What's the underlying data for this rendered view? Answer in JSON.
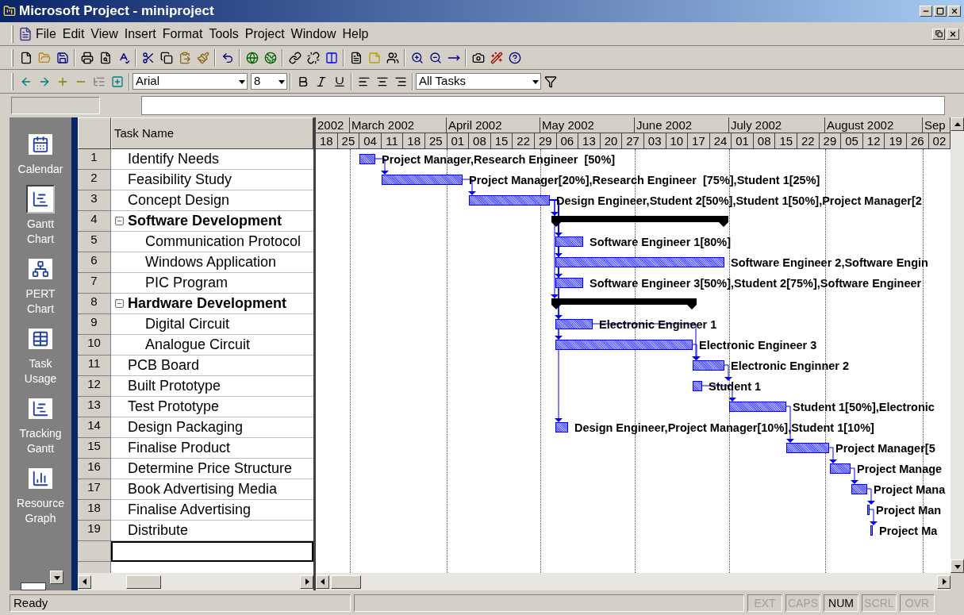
{
  "window": {
    "title": "Microsoft Project - miniproject"
  },
  "menu": [
    "File",
    "Edit",
    "View",
    "Insert",
    "Format",
    "Tools",
    "Project",
    "Window",
    "Help"
  ],
  "formatting": {
    "font": "Arial",
    "size": "8",
    "filter": "All Tasks"
  },
  "view_bar": [
    {
      "label": "Calendar",
      "selected": false
    },
    {
      "label": "Gantt Chart",
      "selected": true
    },
    {
      "label": "PERT Chart",
      "selected": false
    },
    {
      "label": "Task Usage",
      "selected": false
    },
    {
      "label": "Tracking Gantt",
      "selected": false
    },
    {
      "label": "Resource Graph",
      "selected": false
    }
  ],
  "table": {
    "column": "Task Name",
    "tasks": [
      {
        "id": "1",
        "name": "Identify Needs",
        "gantt_label": "Project Manager,Research Engineer  [50%]"
      },
      {
        "id": "2",
        "name": "Feasibility Study",
        "gantt_label": "Project Manager[20%],Research Engineer  [75%],Student 1[25%]"
      },
      {
        "id": "3",
        "name": "Concept Design",
        "gantt_label": "Design Engineer,Student 2[50%],Student 1[50%],Project Manager[2"
      },
      {
        "id": "4",
        "name": "Software Development",
        "expanded": true,
        "children": [
          {
            "id": "5",
            "name": "Communication Protocol",
            "gantt_label": "Software Engineer 1[80%]"
          },
          {
            "id": "6",
            "name": "Windows Application",
            "gantt_label": "Software Engineer 2,Software Engin"
          },
          {
            "id": "7",
            "name": "PIC Program",
            "gantt_label": "Software Engineer 3[50%],Student 2[75%],Software Engineer"
          }
        ]
      },
      {
        "id": "8",
        "name": "Hardware Development",
        "expanded": true,
        "children": [
          {
            "id": "9",
            "name": "Digital Circuit",
            "gantt_label": "Electronic Engineer 1"
          },
          {
            "id": "10",
            "name": "Analogue Circuit",
            "gantt_label": "Electronic Engineer 3"
          }
        ]
      },
      {
        "id": "11",
        "name": "PCB Board",
        "gantt_label": "Electronic Enginner 2"
      },
      {
        "id": "12",
        "name": "Built Prototype",
        "gantt_label": "Student 1"
      },
      {
        "id": "13",
        "name": "Test Prototype",
        "gantt_label": "Student 1[50%],Electronic"
      },
      {
        "id": "14",
        "name": "Design Packaging",
        "gantt_label": "Design Engineer,Project Manager[10%],Student 1[10%]"
      },
      {
        "id": "15",
        "name": "Finalise Product",
        "gantt_label": "Project Manager[5"
      },
      {
        "id": "16",
        "name": "Determine Price Structure",
        "gantt_label": "Project Manage"
      },
      {
        "id": "17",
        "name": "Book Advertising Media",
        "gantt_label": "Project Mana"
      },
      {
        "id": "18",
        "name": "Finalise Advertising",
        "gantt_label": "Project Man"
      },
      {
        "id": "19",
        "name": "Distribute",
        "gantt_label": "Project Ma"
      }
    ]
  },
  "timescale": {
    "months": [
      "2002",
      "March 2002",
      "April 2002",
      "May 2002",
      "June 2002",
      "July 2002",
      "August 2002",
      "Sep"
    ],
    "weeks": [
      "18",
      "25",
      "04",
      "11",
      "18",
      "25",
      "01",
      "08",
      "15",
      "22",
      "29",
      "06",
      "13",
      "20",
      "27",
      "03",
      "10",
      "17",
      "24",
      "01",
      "08",
      "15",
      "22",
      "29",
      "05",
      "12",
      "19",
      "26",
      "02"
    ]
  },
  "status_bar": {
    "text": "Ready",
    "indicators": [
      {
        "label": "EXT",
        "on": false
      },
      {
        "label": "CAPS",
        "on": false
      },
      {
        "label": "NUM",
        "on": true
      },
      {
        "label": "SCRL",
        "on": false
      },
      {
        "label": "OVR",
        "on": false
      }
    ]
  }
}
